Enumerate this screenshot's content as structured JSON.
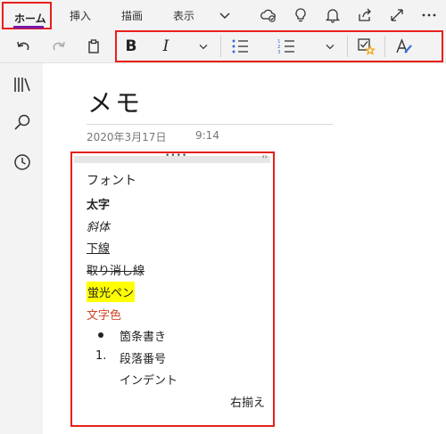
{
  "tabs": [
    {
      "label": "ホーム",
      "selected": true
    },
    {
      "label": "挿入"
    },
    {
      "label": "描画"
    },
    {
      "label": "表示"
    }
  ],
  "tab_icons": [
    "chevron-down-icon",
    "cloud-sync-icon",
    "lightbulb-icon",
    "bell-icon",
    "share-icon",
    "expand-icon",
    "more-icon"
  ],
  "ribbon": {
    "buttons": [
      "undo-icon",
      "redo-icon",
      "paste-icon",
      "bold-button",
      "italic-button",
      "font-dropdown",
      "bullet-list-button",
      "numbered-list-button",
      "list-dropdown",
      "todo-tag-button",
      "styles-button"
    ],
    "bold_glyph": "B",
    "italic_glyph": "I"
  },
  "rail": [
    "notebooks-icon",
    "search-icon",
    "recent-icon"
  ],
  "page": {
    "title": "メモ",
    "date": "2020年3月17日",
    "time": "9:14"
  },
  "note": {
    "handle_dots": "••••",
    "handle_arrows": "‹›",
    "font_label": "フォント",
    "bold": "太字",
    "italic": "斜体",
    "underline": "下線",
    "strikethrough": "取り消し線",
    "highlight": "蛍光ペン",
    "font_color": "文字色",
    "bullet": "箇条書き",
    "number_label": "1.",
    "numbered": "段落番号",
    "indent": "インデント",
    "right_align": "右揃え"
  },
  "colors": {
    "accent": "#7719aa",
    "callout": "#e8201a",
    "highlight": "#ffff00",
    "font_color": "#d24726",
    "tag_star": "#f0a30a"
  }
}
